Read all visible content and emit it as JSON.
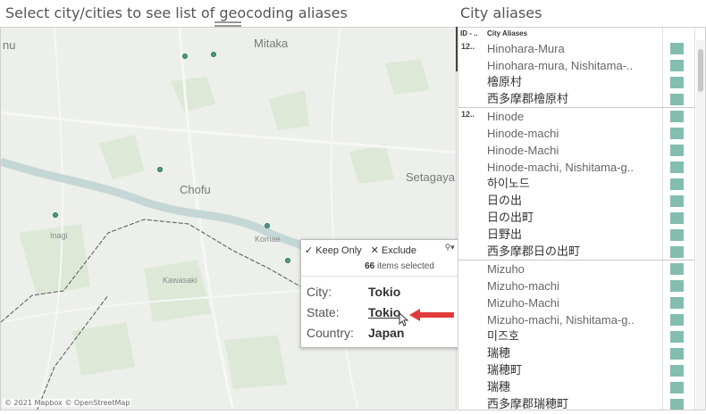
{
  "map_panel": {
    "title": "Select city/cities to see list of geocoding aliases",
    "labels": {
      "mitaka": "Mitaka",
      "chofu": "Chofu",
      "setagaya": "Setagaya",
      "inagi": "Inagi",
      "komae": "Komae",
      "kawasaki": "Kawasaki",
      "partial_left": "nu"
    },
    "attribution": "© 2021 Mapbox © OpenStreetMap",
    "toolbar_icons": [
      "close-icon",
      "fullscreen-icon",
      "filter-icon",
      "dropdown-icon"
    ]
  },
  "tooltip": {
    "actions": {
      "keep_only": "✓ Keep Only",
      "exclude": "✕ Exclude"
    },
    "selected_count": "66",
    "selected_suffix": "items selected",
    "fields": {
      "city_label": "City:",
      "city_value": "Tokio",
      "state_label": "State:",
      "state_value": "Tokio",
      "country_label": "Country:",
      "country_value": "Japan"
    }
  },
  "aliases_panel": {
    "title": "City aliases",
    "header": {
      "id_col": "ID - ..",
      "alias_col": "City Aliases"
    },
    "swatch_color": "#83bdb0",
    "groups": [
      {
        "id": "12..",
        "aliases": [
          "Hinohara-Mura",
          "Hinohara-mura, Nishitama-..",
          "檜原村",
          "西多摩郡檜原村"
        ]
      },
      {
        "id": "12..",
        "aliases": [
          "Hinode",
          "Hinode-machi",
          "Hinode-Machi",
          "Hinode-machi, Nishitama-g..",
          "하이노드",
          "日の出",
          "日の出町",
          "日野出",
          "西多摩郡日の出町"
        ]
      },
      {
        "id": "",
        "aliases": [
          "Mizuho",
          "Mizuho-machi",
          "Mizuho-Machi",
          "Mizuho-machi, Nishitama-g..",
          "미즈호",
          "瑞穂",
          "瑞穂町",
          "瑞穗",
          "西多摩郡瑞穂町"
        ]
      }
    ]
  }
}
